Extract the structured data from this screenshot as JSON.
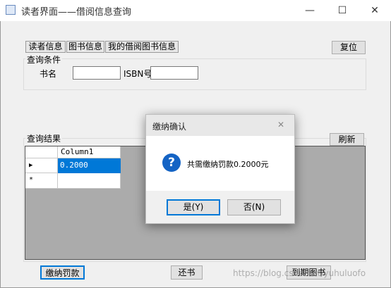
{
  "window": {
    "title": "读者界面——借阅信息查询",
    "min_glyph": "—",
    "max_glyph": "☐",
    "close_glyph": "✕"
  },
  "tabs": [
    "读者信息",
    "图书信息",
    "我的借阅图书信息"
  ],
  "reset_label": "复位",
  "query": {
    "group_label": "查询条件",
    "book_name_label": "书名",
    "book_name_value": "",
    "isbn_label": "ISBN号",
    "isbn_value": ""
  },
  "results": {
    "group_label": "查询结果",
    "refresh_label": "刷新",
    "grid": {
      "columns": [
        "Column1"
      ],
      "rows": [
        {
          "indicator": "▶",
          "value": "0.2000",
          "selected": true
        },
        {
          "indicator": "*",
          "value": "",
          "selected": false
        }
      ]
    }
  },
  "bottom_buttons": {
    "pay_label": "缴纳罚款",
    "return_label": "还书",
    "due_label": "到期图书"
  },
  "dialog": {
    "title": "缴纳确认",
    "close_glyph": "✕",
    "icon_glyph": "?",
    "message": "共需缴纳罚款0.2000元",
    "yes_label": "是(Y)",
    "no_label": "否(N)"
  },
  "watermark": "https://blog.csdn.net/yuhuluofo",
  "colors": {
    "selected_row": "#0078d7",
    "grid_background": "#ababab",
    "question_icon": "#1463c4"
  }
}
